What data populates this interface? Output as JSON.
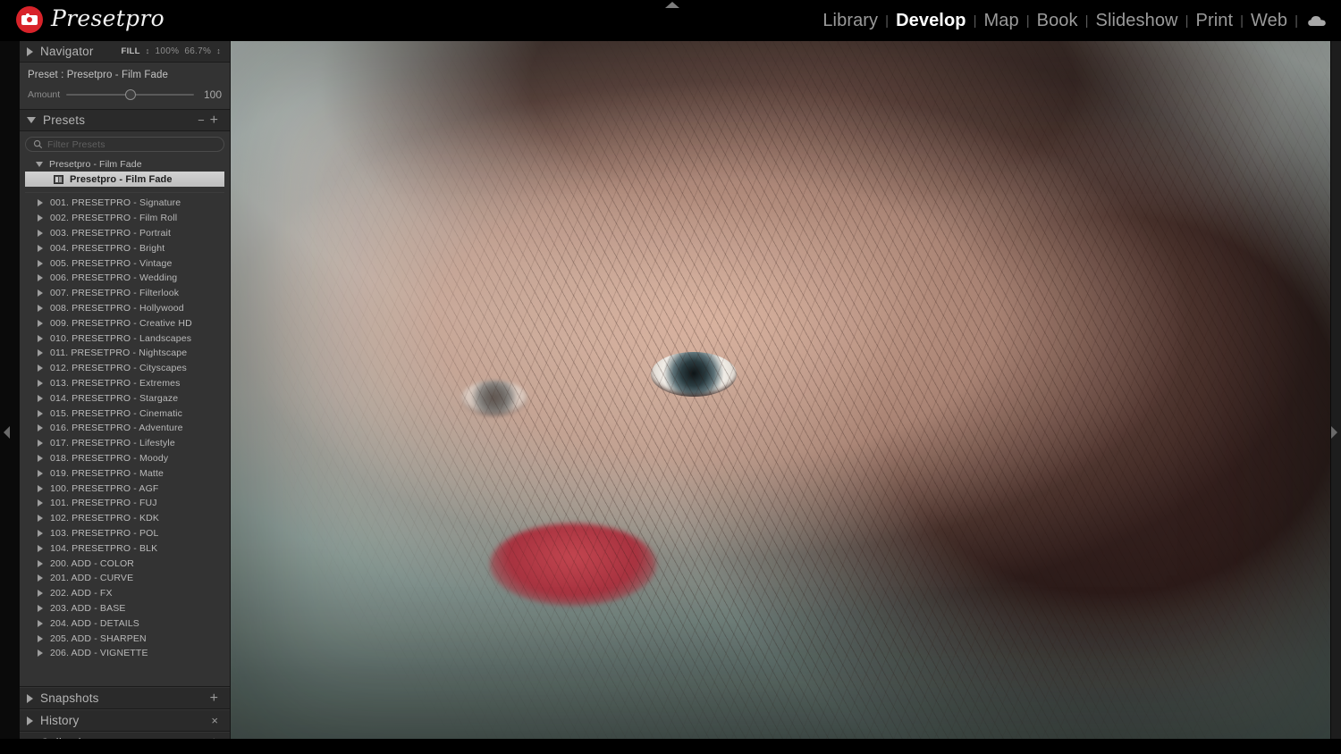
{
  "app": {
    "brand_name": "Presetpro",
    "brand_icon": "camera-icon"
  },
  "modules": {
    "items": [
      {
        "label": "Library",
        "active": false
      },
      {
        "label": "Develop",
        "active": true
      },
      {
        "label": "Map",
        "active": false
      },
      {
        "label": "Book",
        "active": false
      },
      {
        "label": "Slideshow",
        "active": false
      },
      {
        "label": "Print",
        "active": false
      },
      {
        "label": "Web",
        "active": false
      }
    ],
    "separator": "|",
    "cloud_icon": "cloud-icon"
  },
  "navigator": {
    "title": "Navigator",
    "fill_label": "FILL",
    "zoom_100": "100%",
    "zoom_fit": "66.7%",
    "preset_label": "Preset : Presetpro - Film Fade",
    "amount_label": "Amount",
    "amount_value": "100"
  },
  "presets": {
    "title": "Presets",
    "minus_label": "−",
    "plus_label": "+",
    "filter_placeholder": "Filter Presets",
    "filter_value": "",
    "search_icon": "search-icon",
    "active_group": "Presetpro - Film Fade",
    "active_preset": "Presetpro - Film Fade",
    "groups": [
      "001. PRESETPRO - Signature",
      "002. PRESETPRO - Film Roll",
      "003. PRESETPRO - Portrait",
      "004. PRESETPRO - Bright",
      "005. PRESETPRO - Vintage",
      "006. PRESETPRO - Wedding",
      "007. PRESETPRO - Filterlook",
      "008. PRESETPRO - Hollywood",
      "009. PRESETPRO - Creative HD",
      "010. PRESETPRO - Landscapes",
      "011. PRESETPRO - Nightscape",
      "012. PRESETPRO - Cityscapes",
      "013. PRESETPRO - Extremes",
      "014. PRESETPRO - Stargaze",
      "015. PRESETPRO - Cinematic",
      "016. PRESETPRO - Adventure",
      "017. PRESETPRO - Lifestyle",
      "018. PRESETPRO - Moody",
      "019. PRESETPRO - Matte",
      "100. PRESETPRO - AGF",
      "101. PRESETPRO - FUJ",
      "102. PRESETPRO - KDK",
      "103. PRESETPRO - POL",
      "104. PRESETPRO - BLK",
      "200. ADD - COLOR",
      "201. ADD - CURVE",
      "202. ADD - FX",
      "203. ADD - BASE",
      "204. ADD - DETAILS",
      "205. ADD - SHARPEN",
      "206. ADD - VIGNETTE"
    ]
  },
  "snapshots": {
    "title": "Snapshots",
    "plus_label": "+"
  },
  "history": {
    "title": "History",
    "clear_label": "×"
  },
  "collections": {
    "title": "Collections",
    "plus_label": "+"
  },
  "colors": {
    "brand_red": "#d8232a",
    "panel_bg": "#2a2a2a",
    "panel_body_bg": "#333333",
    "selected_row_bg": "#c8c8c8",
    "text_primary": "#b9b9b9",
    "text_active": "#ffffff"
  }
}
